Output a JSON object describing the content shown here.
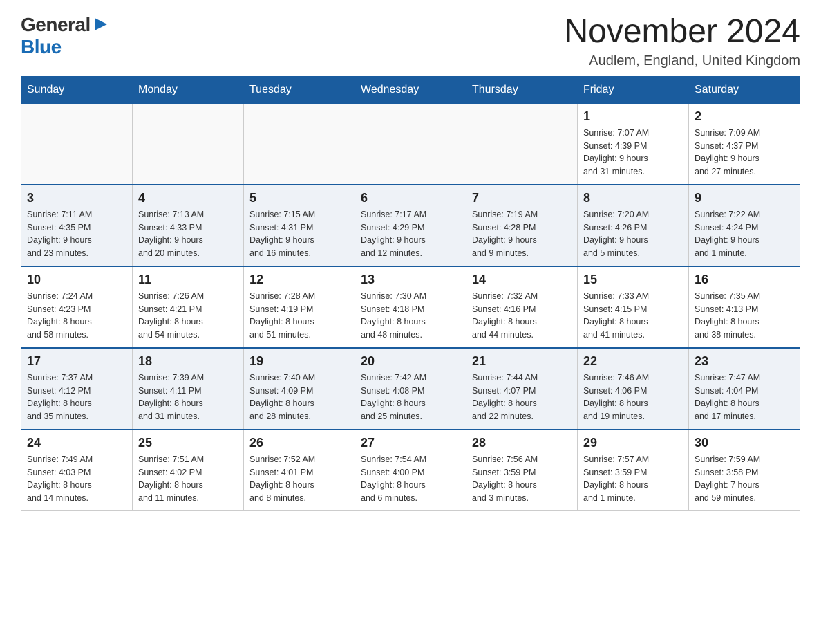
{
  "logo": {
    "general": "General",
    "blue": "Blue"
  },
  "title": {
    "month_year": "November 2024",
    "location": "Audlem, England, United Kingdom"
  },
  "weekdays": [
    "Sunday",
    "Monday",
    "Tuesday",
    "Wednesday",
    "Thursday",
    "Friday",
    "Saturday"
  ],
  "rows": [
    {
      "cells": [
        {
          "day": "",
          "info": ""
        },
        {
          "day": "",
          "info": ""
        },
        {
          "day": "",
          "info": ""
        },
        {
          "day": "",
          "info": ""
        },
        {
          "day": "",
          "info": ""
        },
        {
          "day": "1",
          "info": "Sunrise: 7:07 AM\nSunset: 4:39 PM\nDaylight: 9 hours\nand 31 minutes."
        },
        {
          "day": "2",
          "info": "Sunrise: 7:09 AM\nSunset: 4:37 PM\nDaylight: 9 hours\nand 27 minutes."
        }
      ]
    },
    {
      "cells": [
        {
          "day": "3",
          "info": "Sunrise: 7:11 AM\nSunset: 4:35 PM\nDaylight: 9 hours\nand 23 minutes."
        },
        {
          "day": "4",
          "info": "Sunrise: 7:13 AM\nSunset: 4:33 PM\nDaylight: 9 hours\nand 20 minutes."
        },
        {
          "day": "5",
          "info": "Sunrise: 7:15 AM\nSunset: 4:31 PM\nDaylight: 9 hours\nand 16 minutes."
        },
        {
          "day": "6",
          "info": "Sunrise: 7:17 AM\nSunset: 4:29 PM\nDaylight: 9 hours\nand 12 minutes."
        },
        {
          "day": "7",
          "info": "Sunrise: 7:19 AM\nSunset: 4:28 PM\nDaylight: 9 hours\nand 9 minutes."
        },
        {
          "day": "8",
          "info": "Sunrise: 7:20 AM\nSunset: 4:26 PM\nDaylight: 9 hours\nand 5 minutes."
        },
        {
          "day": "9",
          "info": "Sunrise: 7:22 AM\nSunset: 4:24 PM\nDaylight: 9 hours\nand 1 minute."
        }
      ]
    },
    {
      "cells": [
        {
          "day": "10",
          "info": "Sunrise: 7:24 AM\nSunset: 4:23 PM\nDaylight: 8 hours\nand 58 minutes."
        },
        {
          "day": "11",
          "info": "Sunrise: 7:26 AM\nSunset: 4:21 PM\nDaylight: 8 hours\nand 54 minutes."
        },
        {
          "day": "12",
          "info": "Sunrise: 7:28 AM\nSunset: 4:19 PM\nDaylight: 8 hours\nand 51 minutes."
        },
        {
          "day": "13",
          "info": "Sunrise: 7:30 AM\nSunset: 4:18 PM\nDaylight: 8 hours\nand 48 minutes."
        },
        {
          "day": "14",
          "info": "Sunrise: 7:32 AM\nSunset: 4:16 PM\nDaylight: 8 hours\nand 44 minutes."
        },
        {
          "day": "15",
          "info": "Sunrise: 7:33 AM\nSunset: 4:15 PM\nDaylight: 8 hours\nand 41 minutes."
        },
        {
          "day": "16",
          "info": "Sunrise: 7:35 AM\nSunset: 4:13 PM\nDaylight: 8 hours\nand 38 minutes."
        }
      ]
    },
    {
      "cells": [
        {
          "day": "17",
          "info": "Sunrise: 7:37 AM\nSunset: 4:12 PM\nDaylight: 8 hours\nand 35 minutes."
        },
        {
          "day": "18",
          "info": "Sunrise: 7:39 AM\nSunset: 4:11 PM\nDaylight: 8 hours\nand 31 minutes."
        },
        {
          "day": "19",
          "info": "Sunrise: 7:40 AM\nSunset: 4:09 PM\nDaylight: 8 hours\nand 28 minutes."
        },
        {
          "day": "20",
          "info": "Sunrise: 7:42 AM\nSunset: 4:08 PM\nDaylight: 8 hours\nand 25 minutes."
        },
        {
          "day": "21",
          "info": "Sunrise: 7:44 AM\nSunset: 4:07 PM\nDaylight: 8 hours\nand 22 minutes."
        },
        {
          "day": "22",
          "info": "Sunrise: 7:46 AM\nSunset: 4:06 PM\nDaylight: 8 hours\nand 19 minutes."
        },
        {
          "day": "23",
          "info": "Sunrise: 7:47 AM\nSunset: 4:04 PM\nDaylight: 8 hours\nand 17 minutes."
        }
      ]
    },
    {
      "cells": [
        {
          "day": "24",
          "info": "Sunrise: 7:49 AM\nSunset: 4:03 PM\nDaylight: 8 hours\nand 14 minutes."
        },
        {
          "day": "25",
          "info": "Sunrise: 7:51 AM\nSunset: 4:02 PM\nDaylight: 8 hours\nand 11 minutes."
        },
        {
          "day": "26",
          "info": "Sunrise: 7:52 AM\nSunset: 4:01 PM\nDaylight: 8 hours\nand 8 minutes."
        },
        {
          "day": "27",
          "info": "Sunrise: 7:54 AM\nSunset: 4:00 PM\nDaylight: 8 hours\nand 6 minutes."
        },
        {
          "day": "28",
          "info": "Sunrise: 7:56 AM\nSunset: 3:59 PM\nDaylight: 8 hours\nand 3 minutes."
        },
        {
          "day": "29",
          "info": "Sunrise: 7:57 AM\nSunset: 3:59 PM\nDaylight: 8 hours\nand 1 minute."
        },
        {
          "day": "30",
          "info": "Sunrise: 7:59 AM\nSunset: 3:58 PM\nDaylight: 7 hours\nand 59 minutes."
        }
      ]
    }
  ]
}
